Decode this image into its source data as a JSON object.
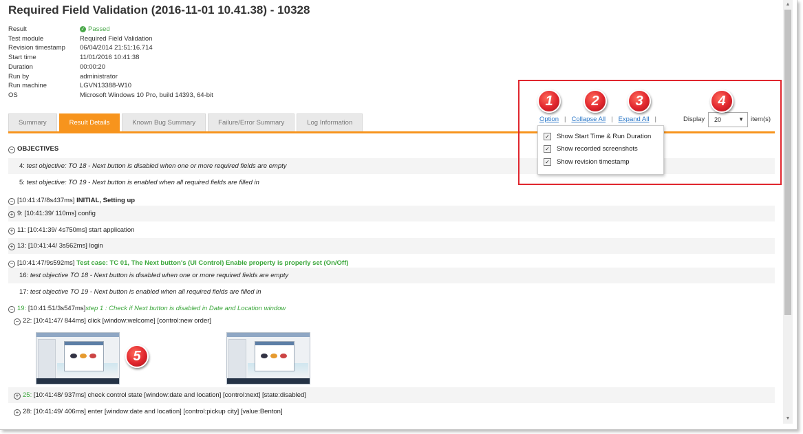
{
  "page": {
    "title": "Required Field Validation (2016-11-01 10.41.38) - 10328"
  },
  "meta": [
    {
      "label": "Result",
      "value": "Passed"
    },
    {
      "label": "Test module",
      "value": "Required Field Validation"
    },
    {
      "label": "Revision timestamp",
      "value": "06/04/2014 21:51:16.714"
    },
    {
      "label": "Start time",
      "value": "11/01/2016 10:41:38"
    },
    {
      "label": "Duration",
      "value": "00:00:20"
    },
    {
      "label": "Run by",
      "value": "administrator"
    },
    {
      "label": "Run machine",
      "value": "LGVN13388-W10"
    },
    {
      "label": "OS",
      "value": "Microsoft Windows 10 Pro, build 14393, 64-bit"
    }
  ],
  "tabs": [
    "Summary",
    "Result Details",
    "Known Bug Summary",
    "Failure/Error Summary",
    "Log Information"
  ],
  "active_tab": "Result Details",
  "toolbar": {
    "option": "Option",
    "collapse_all": "Collapse All",
    "expand_all": "Expand All",
    "separator": "|",
    "display_label": "Display",
    "display_value": "20",
    "items_label": "item(s)"
  },
  "options_menu": [
    {
      "label": "Show Start Time & Run Duration",
      "checked": true
    },
    {
      "label": "Show recorded screenshots",
      "checked": true
    },
    {
      "label": "Show revision timestamp",
      "checked": true
    }
  ],
  "badges": [
    "1",
    "2",
    "3",
    "4",
    "5"
  ],
  "icons": {
    "expand": "plus-circle-icon",
    "collapse": "minus-circle-icon",
    "passed": "check-circle-icon"
  },
  "colors": {
    "accent": "#f7941d",
    "pass": "#3aa63a",
    "link": "#2b77c7",
    "callout": "#e0262e"
  },
  "rows": {
    "objectives": {
      "toggle": "⊖",
      "label": "OBJECTIVES"
    },
    "obj4": {
      "num": "4:",
      "text": "test objective: TO 18 - Next button is disabled when one or more required fields are empty"
    },
    "obj5": {
      "num": "5:",
      "text": "test objective: TO 19 - Next button is enabled when all required fields are filled in"
    },
    "initial": {
      "toggle": "⊖",
      "time": "[10:41:47/8s437ms]",
      "label": "INITIAL, Setting up"
    },
    "r9": {
      "toggle": "⊕",
      "text": "9: [10:41:39/ 110ms] config"
    },
    "r11": {
      "toggle": "⊕",
      "text": "11: [10:41:39/ 4s750ms] start application"
    },
    "r13": {
      "toggle": "⊕",
      "text": "13: [10:41:44/ 3s562ms] login"
    },
    "tc01": {
      "toggle": "⊖",
      "time": "[10:41:47/9s592ms]",
      "label": "Test case: TC 01, The Next button's (UI Control) Enable property is properly set (On/Off)"
    },
    "obj16": {
      "num": "16:",
      "text": "test objective TO 18 - Next button is disabled when one or more required fields are empty"
    },
    "obj17": {
      "num": "17:",
      "text": "test objective TO 19 - Next button is enabled when all required fields are filled in"
    },
    "r19": {
      "toggle": "⊖",
      "num": "19:",
      "time": "[10:41:51/3s547ms]",
      "label": "step 1 : Check if Next button is disabled in Date and Location window"
    },
    "r22": {
      "toggle": "⊖",
      "text": "22: [10:41:47/ 844ms] click  [window:welcome] [control:new order]"
    },
    "r25": {
      "toggle": "⊕",
      "num": "25:",
      "text": "[10:41:48/ 937ms] check control state  [window:date and location] [control:next] [state:disabled]"
    },
    "r28": {
      "toggle": "⊕",
      "text": "28: [10:41:49/ 406ms] enter  [window:date and location] [control:pickup city] [value:Benton]"
    }
  }
}
